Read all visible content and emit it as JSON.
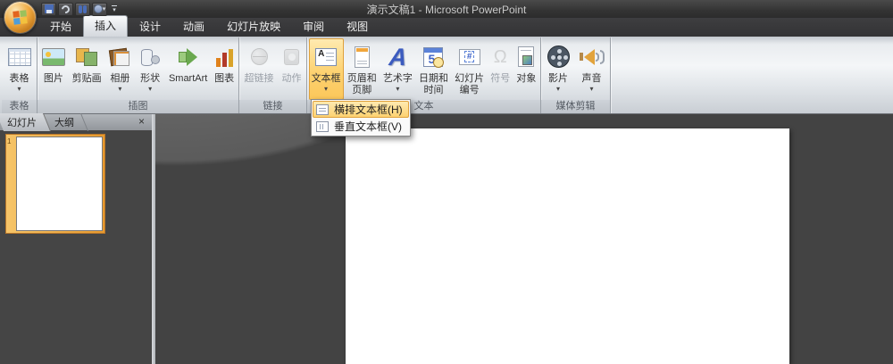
{
  "window": {
    "title": "演示文稿1 - Microsoft PowerPoint"
  },
  "tabs": [
    "开始",
    "插入",
    "设计",
    "动画",
    "幻灯片放映",
    "审阅",
    "视图"
  ],
  "active_tab": "插入",
  "ribbon": {
    "groups": [
      {
        "label": "表格"
      },
      {
        "label": "插图"
      },
      {
        "label": "链接"
      },
      {
        "label": "文本"
      },
      {
        "label": "媒体剪辑"
      }
    ],
    "buttons": {
      "table": "表格",
      "picture": "图片",
      "clipart": "剪贴画",
      "album": "相册",
      "shapes": "形状",
      "smartart": "SmartArt",
      "chart": "图表",
      "hyperlink": "超链接",
      "action": "动作",
      "textbox": "文本框",
      "header_footer_line1": "页眉和",
      "header_footer_line2": "页脚",
      "wordart": "艺术字",
      "datetime_line1": "日期和",
      "datetime_line2": "时间",
      "slide_number_line1": "幻灯片",
      "slide_number_line2": "编号",
      "symbol": "符号",
      "object": "对象",
      "movie": "影片",
      "sound": "声音"
    }
  },
  "textbox_menu": {
    "items": [
      {
        "label": "横排文本框(H)",
        "highlighted": true
      },
      {
        "label": "垂直文本框(V)",
        "highlighted": false
      }
    ]
  },
  "left_pane": {
    "tab_slides": "幻灯片",
    "tab_outline": "大纲",
    "close": "×",
    "slide_number": "1"
  },
  "icons": {
    "dropdown_arrow": "▾",
    "textbox_glyph": "A",
    "wordart_glyph": "A",
    "symbol_glyph": "Ω",
    "slide_number_glyph": "#",
    "date_glyph": "5"
  },
  "colors": {
    "highlight_orange": "#fdd271",
    "selection_frame": "#e89a2e",
    "ribbon_face": "#e9ecef",
    "workspace": "#434343",
    "titlebar": "#333333"
  }
}
